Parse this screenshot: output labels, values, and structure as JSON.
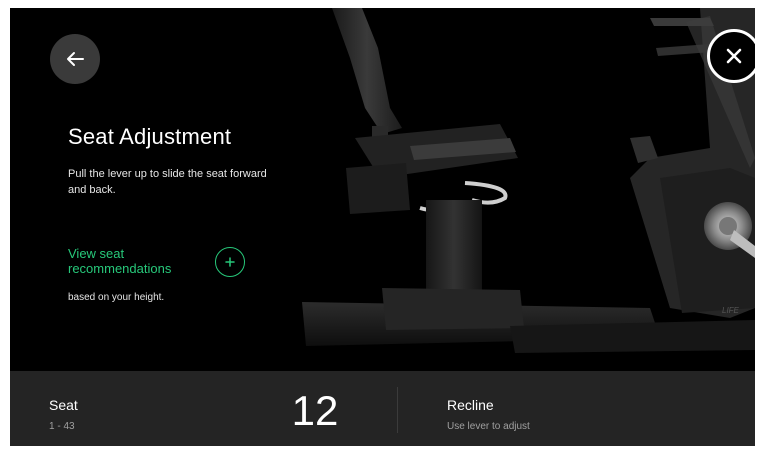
{
  "header": {
    "back_icon": "arrow-left-icon",
    "close_icon": "close-icon"
  },
  "panel": {
    "title": "Seat Adjustment",
    "description": "Pull the lever up to slide the seat forward and back.",
    "recommendation_link": "View seat recommendations",
    "recommendation_icon": "plus-icon",
    "recommendation_sub": "based on your height."
  },
  "bottom_bar": {
    "seat_label": "Seat",
    "seat_range": "1 - 43",
    "seat_value": "12",
    "recline_label": "Recline",
    "recline_hint": "Use lever to adjust"
  },
  "colors": {
    "accent": "#27c87a",
    "background": "#000000",
    "bar": "#242424"
  }
}
